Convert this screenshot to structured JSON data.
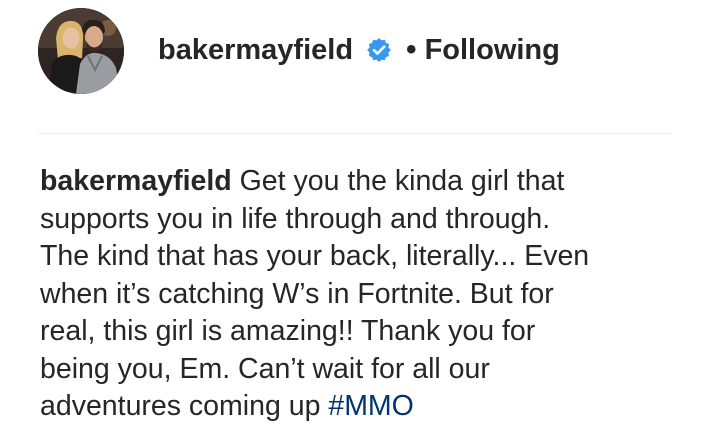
{
  "post": {
    "username": "bakermayfield",
    "separator": "•",
    "follow_status": "Following",
    "verified_icon": "verified-badge-icon",
    "avatar_alt": "profile photo",
    "accent_colors": {
      "verified": "#3897f0",
      "hashtag": "#003569",
      "text": "#262626",
      "divider": "#efefef"
    }
  },
  "caption": {
    "username": "bakermayfield",
    "line1": "Get you the kinda girl that",
    "line2": "supports you in life through and through.",
    "line3": "The kind that has your back, literally... Even",
    "line4": "when it’s catching W’s in Fortnite. But for",
    "line5": "real, this girl is amazing!! Thank you for",
    "line6": "being you, Em. Can’t wait for all our",
    "line7": "adventures coming up",
    "hashtag": "#MMO"
  }
}
